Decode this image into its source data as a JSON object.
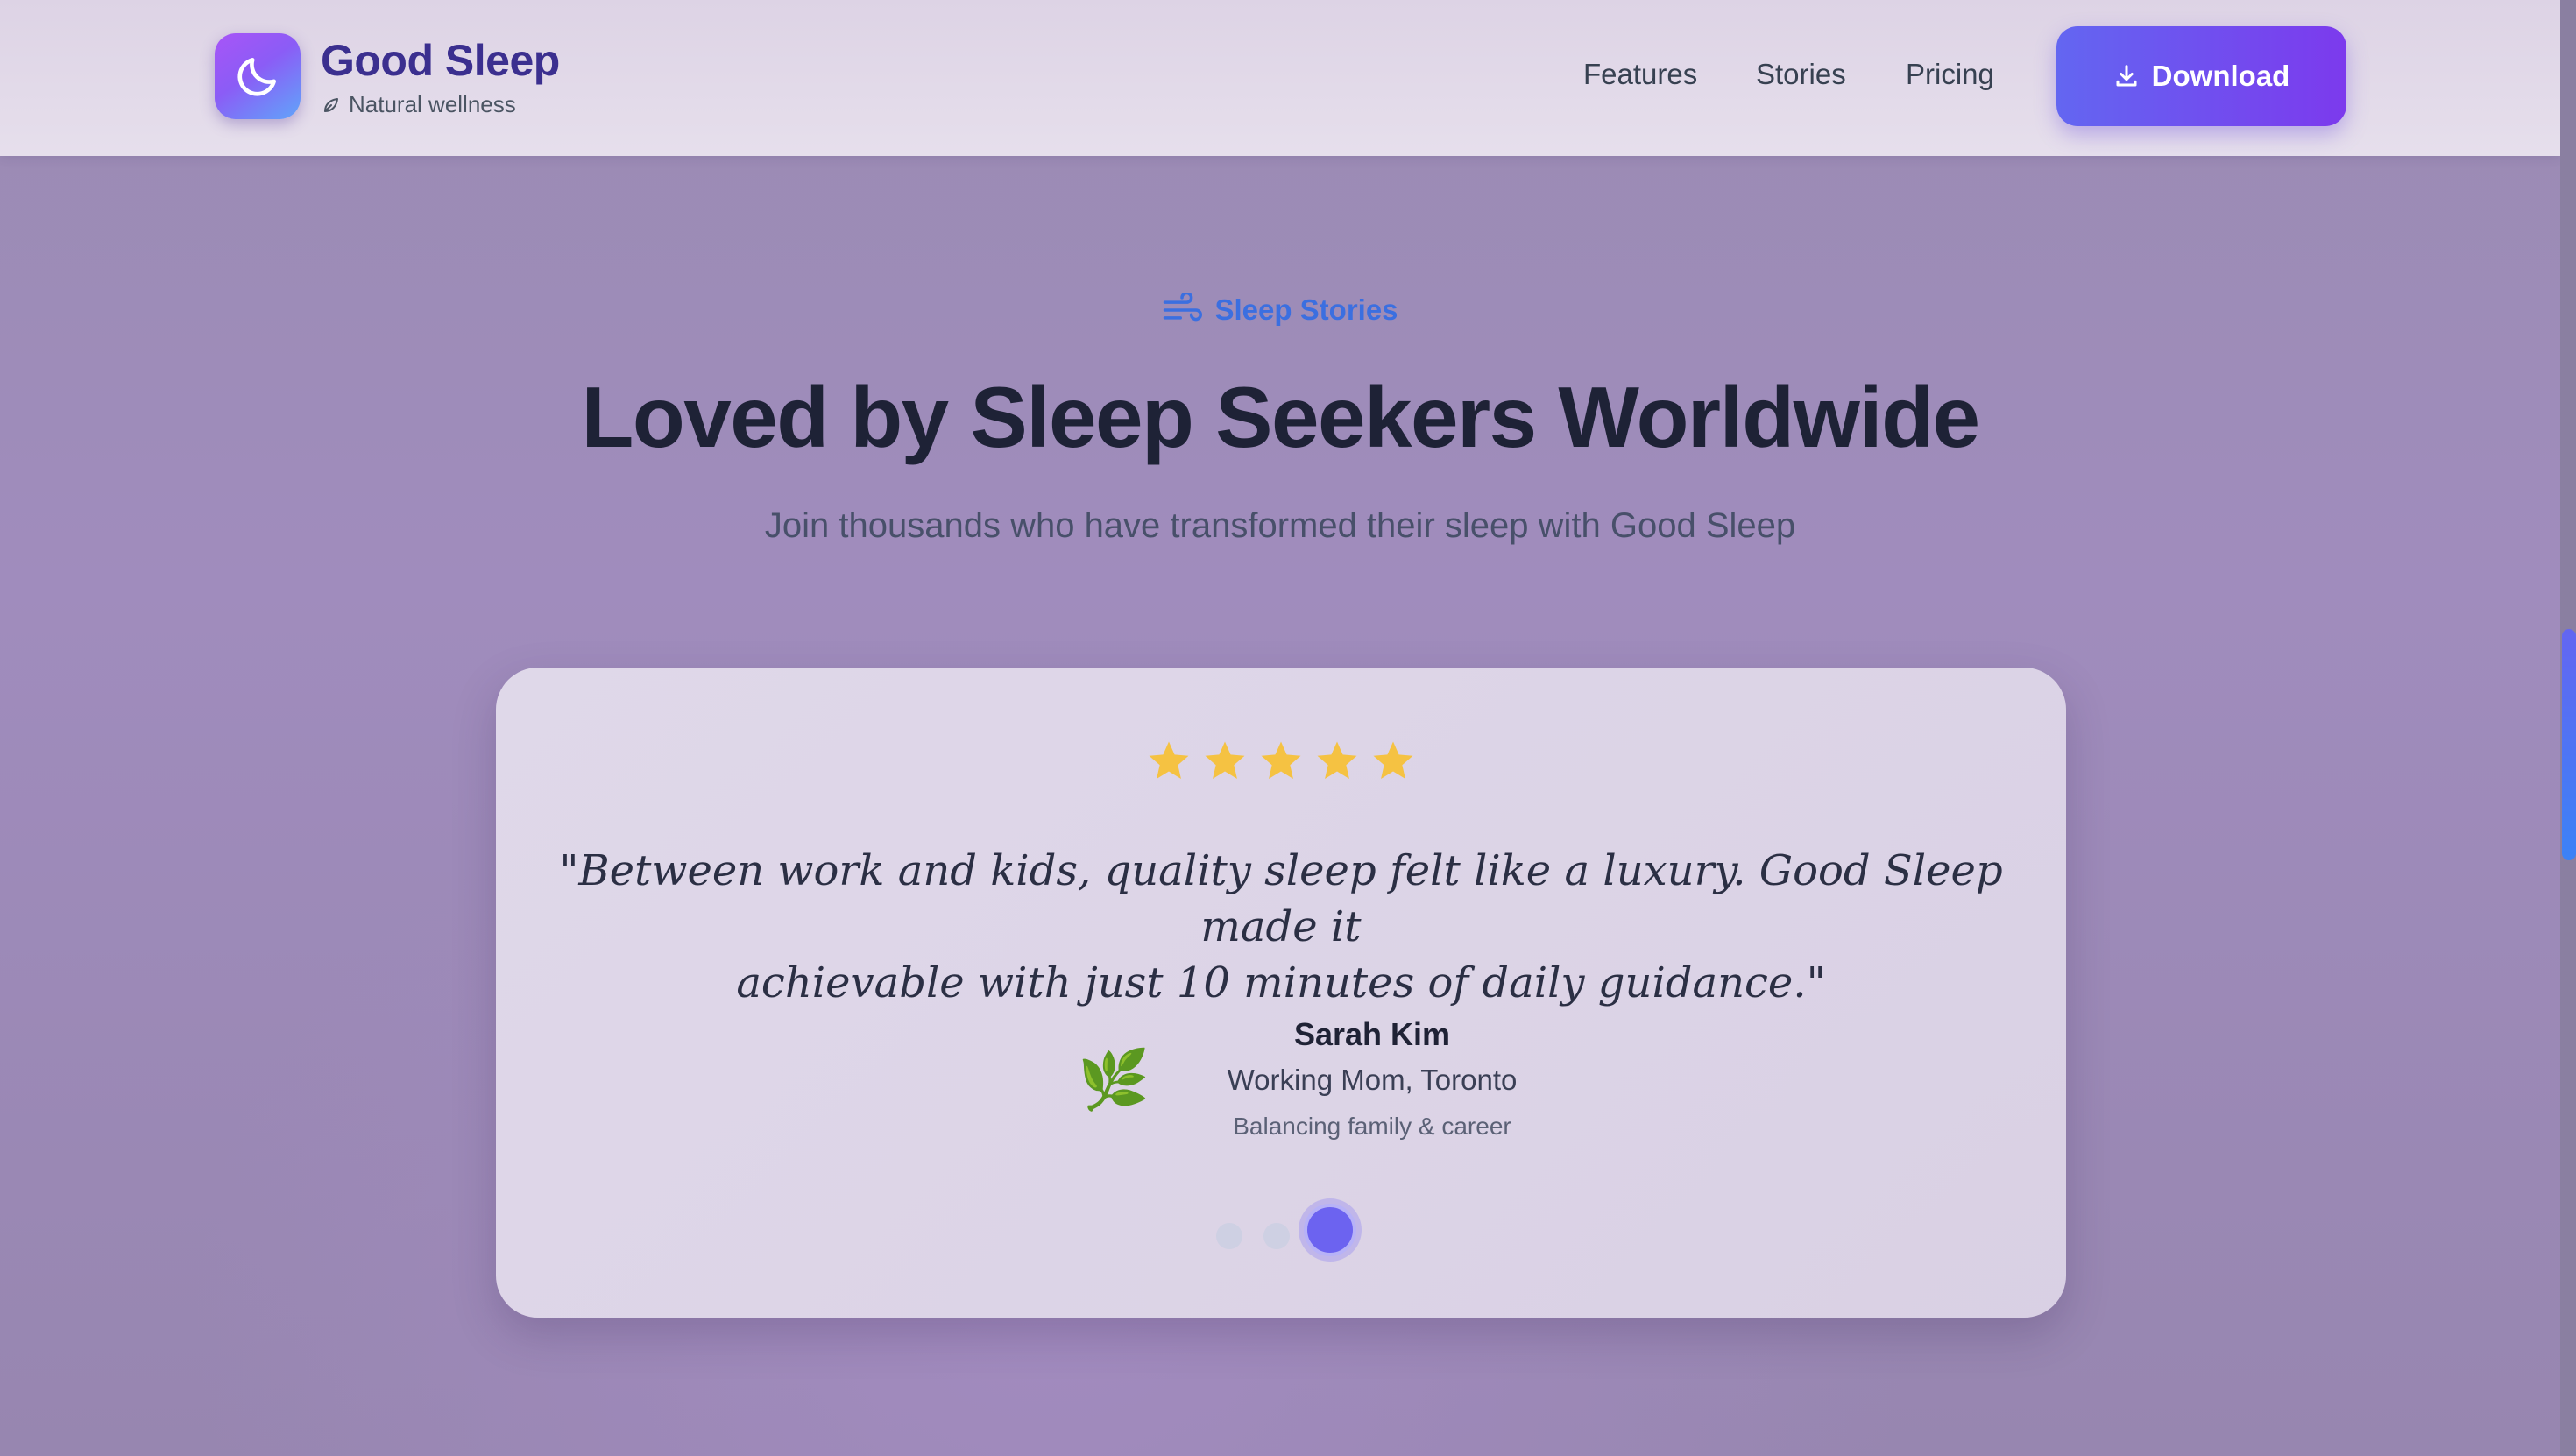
{
  "header": {
    "brand_name": "Good Sleep",
    "brand_tagline": "Natural wellness",
    "nav": [
      "Features",
      "Stories",
      "Pricing"
    ],
    "download_label": "Download"
  },
  "section": {
    "eyebrow": "Sleep Stories",
    "title": "Loved by Sleep Seekers Worldwide",
    "subtitle": "Join thousands who have transformed their sleep with Good Sleep"
  },
  "testimonial": {
    "rating": 5,
    "quote_line1": "\"Between work and kids, quality sleep felt like a luxury. Good Sleep made it",
    "quote_line2": "achievable with just 10 minutes of daily guidance.\"",
    "avatar_emoji": "🌿",
    "author_name": "Sarah Kim",
    "author_role": "Working Mom, Toronto",
    "author_note": "Balancing family & career",
    "active_slide": 3,
    "total_slides": 3
  },
  "colors": {
    "accent": "#6366f1",
    "brand": "#3b2f8f",
    "star": "#f5c242",
    "eyebrow": "#3b6fe0"
  },
  "icons": {
    "logo": "moon-icon",
    "tagline": "leaf-icon",
    "download": "download-icon",
    "eyebrow": "wind-icon",
    "rating": "star-icon"
  }
}
